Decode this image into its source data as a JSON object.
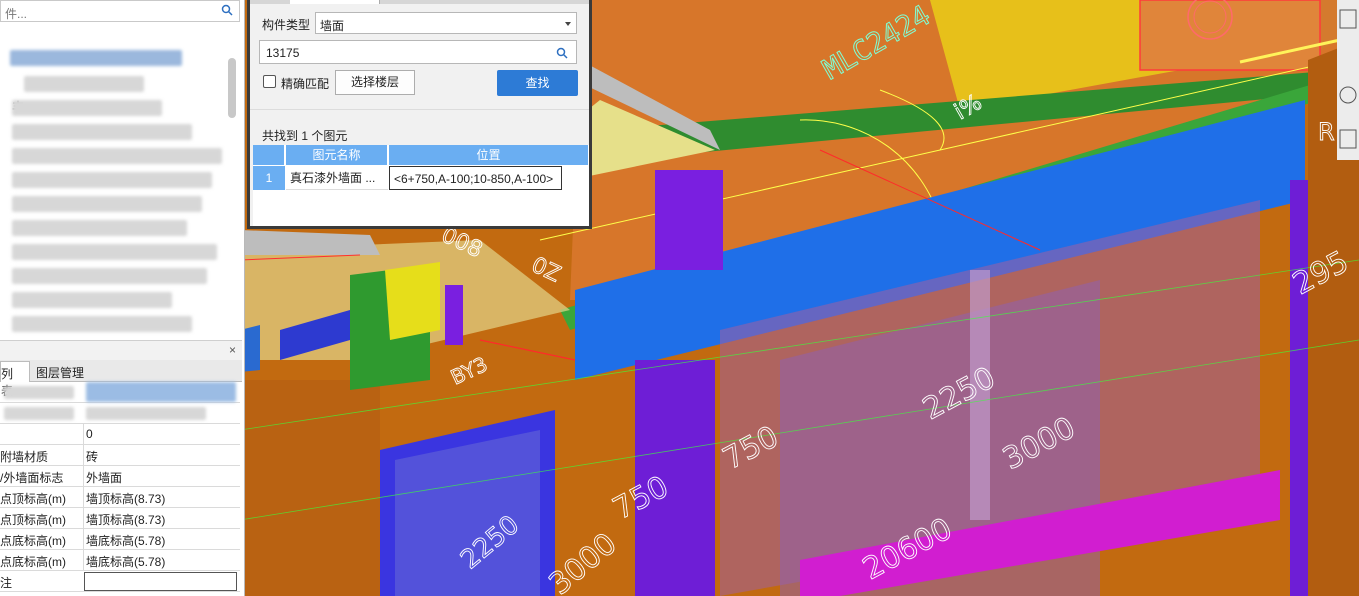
{
  "left_panel": {
    "search_placeholder": "件...",
    "tree_mark": "丰",
    "tabs": [
      {
        "label": "列表"
      },
      {
        "label": "图层管理"
      }
    ],
    "close_glyph": "×",
    "properties": [
      {
        "key": "",
        "value": ""
      },
      {
        "key": "",
        "value": ""
      },
      {
        "key": "",
        "value": "0"
      },
      {
        "key": "附墙材质",
        "value": "砖"
      },
      {
        "key": "/外墙面标志",
        "value": "外墙面"
      },
      {
        "key": "点顶标高(m)",
        "value": "墙顶标高(8.73)"
      },
      {
        "key": "点顶标高(m)",
        "value": "墙顶标高(8.73)"
      },
      {
        "key": "点底标高(m)",
        "value": "墙底标高(5.78)"
      },
      {
        "key": "点底标高(m)",
        "value": "墙底标高(5.78)"
      },
      {
        "key": "注",
        "value": ""
      }
    ]
  },
  "find_dialog": {
    "component_type_label": "构件类型",
    "component_type_value": "墙面",
    "search_value": "13175",
    "exact_match_label": "精确匹配",
    "exact_match_checked": false,
    "select_floor_button": "选择楼层",
    "find_button": "查找",
    "result_count": "共找到 1 个图元",
    "columns": [
      "图元名称",
      "位置"
    ],
    "rows": [
      {
        "index": "1",
        "name": "真石漆外墙面 ...",
        "position": "<6+750,A-100;10-850,A-100>"
      }
    ]
  },
  "viewport": {
    "labels": [
      "MLC2424",
      "i%",
      "008",
      "0Z",
      "BY3",
      "2250",
      "3000",
      "750",
      "750",
      "20600",
      "3000",
      "2250",
      "295",
      "R"
    ]
  },
  "colors": {
    "wall_orange": "#c8690f",
    "highlight_blue": "#1f6fe8",
    "purple": "#7a1fe0",
    "green": "#2a8a2a",
    "yellow": "#e6de1a",
    "accent_button": "#2d7bd6",
    "grid_header": "#6aaef2"
  }
}
